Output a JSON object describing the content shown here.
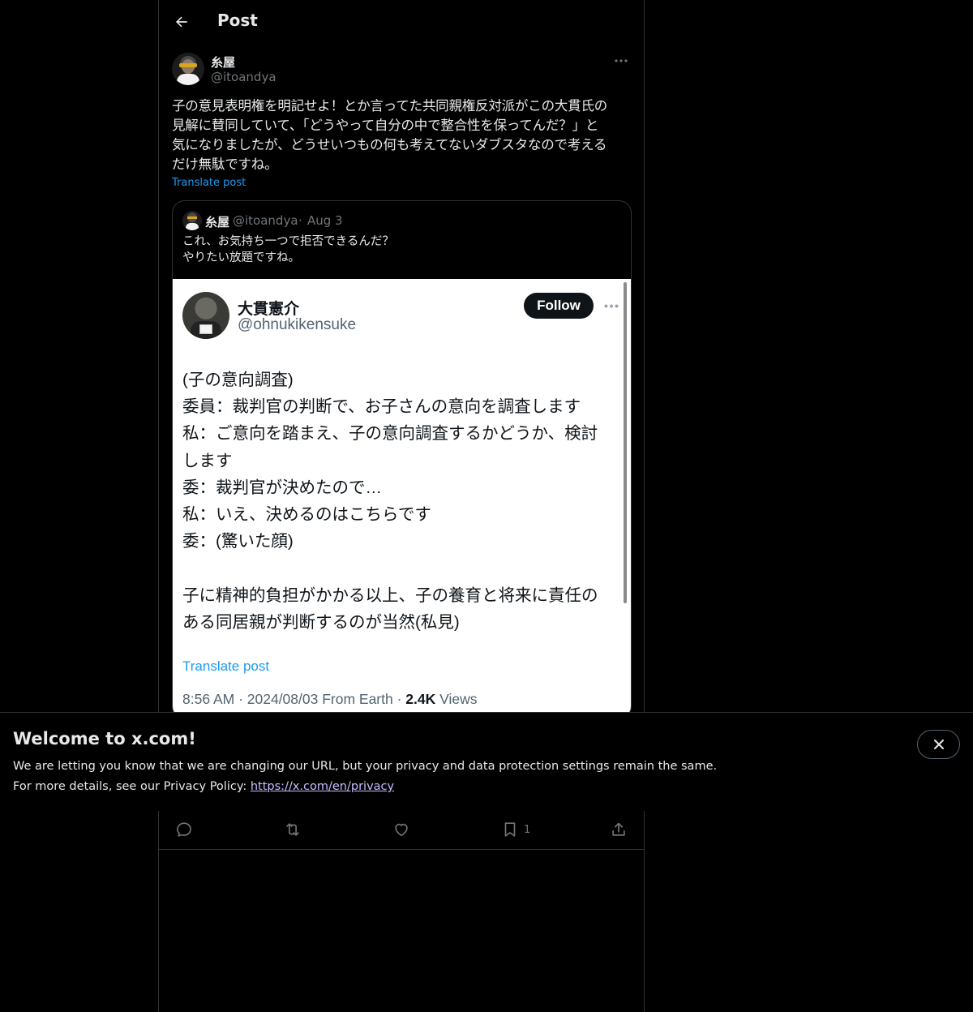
{
  "header": {
    "title": "Post",
    "back_icon": "arrow-left-icon"
  },
  "post": {
    "author_name": "糸屋",
    "author_handle": "@itoandya",
    "text": "子の意見表明権を明記せよ！とか言ってた共同親権反対派がこの大貫氏の\n見解に賛同していて、「どうやって自分の中で整合性を保ってんだ？」と\n気になりましたが、どうせいつもの何も考えてないダブスタなので考える\nだけ無駄ですね。",
    "translate_label": "Translate post"
  },
  "quote": {
    "author_name": "糸屋",
    "author_handle": "@itoandya",
    "separator": "·",
    "date": "Aug 3",
    "text": "これ、お気持ち一つで拒否できるんだ？\nやりたい放題ですね。"
  },
  "screenshot": {
    "name": "大貫憲介",
    "handle": "@ohnukikensuke",
    "follow_label": "Follow",
    "lines": [
      "(子の意向調査)",
      "委員：裁判官の判断で、お子さんの意向を調査します",
      "私：ご意向を踏まえ、子の意向調査するかどうか、検討",
      "します",
      "委：裁判官が決めたので…",
      "私：いえ、決めるのはこちらです",
      "委：(驚いた顔)",
      "",
      "子に精神的負担がかかる以上、子の養育と将来に責任の",
      "ある同居親が判断するのが当然(私見)"
    ],
    "translate_label": "Translate post",
    "meta_prefix": "8:56 AM · 2024/08/03 From Earth · ",
    "views_count": "2.4K",
    "views_label": " Views"
  },
  "actions": {
    "reply_icon": "reply-icon",
    "repost_icon": "repost-icon",
    "like_icon": "heart-icon",
    "bookmark_icon": "bookmark-icon",
    "bookmark_count": "1",
    "share_icon": "share-icon"
  },
  "banner": {
    "title": "Welcome to x.com!",
    "line1": "We are letting you know that we are changing our URL, but your privacy and data protection settings remain the same.",
    "line2_prefix": "For more details, see our Privacy Policy: ",
    "link": "https://x.com/en/privacy"
  },
  "colors": {
    "background": "#000000",
    "text": "#e7e9ea",
    "muted": "#71767b",
    "accent": "#1d9bf0",
    "border": "#2f3336"
  }
}
